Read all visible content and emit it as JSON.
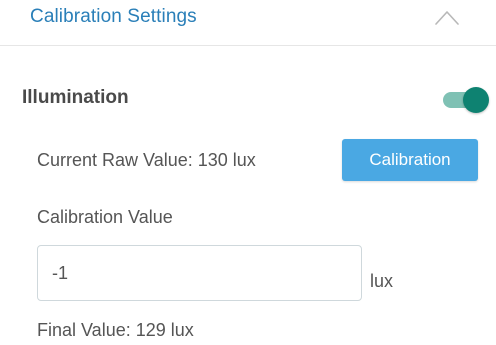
{
  "header": {
    "title": "Calibration Settings",
    "collapse_icon": "chevron-up-icon"
  },
  "illumination": {
    "title": "Illumination",
    "enabled": true,
    "current_raw_label": "Current Raw Value:",
    "current_raw_value": "130 lux",
    "calibration_button_label": "Calibration",
    "calibration_value_label": "Calibration Value",
    "calibration_value": "-1",
    "unit": "lux",
    "final_label": "Final Value:",
    "final_value": "129 lux"
  },
  "colors": {
    "accent": "#2a7fb8",
    "button": "#4aa8e3",
    "toggle_on": "#0e8271",
    "toggle_track": "#7fc1b4"
  }
}
